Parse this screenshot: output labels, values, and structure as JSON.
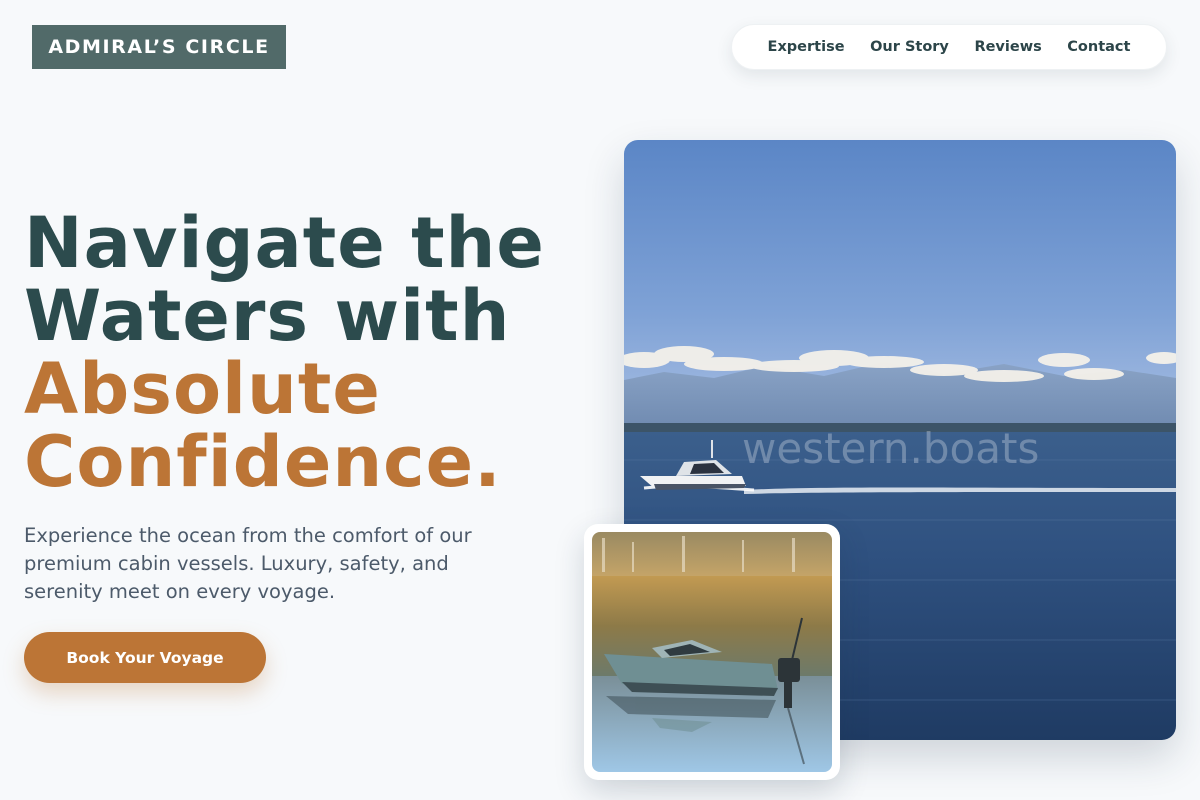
{
  "brand": {
    "name": "ADMIRAL’S CIRCLE"
  },
  "nav": {
    "items": [
      {
        "label": "Expertise"
      },
      {
        "label": "Our Story"
      },
      {
        "label": "Reviews"
      },
      {
        "label": "Contact"
      }
    ]
  },
  "hero": {
    "headline_line1": "Navigate the",
    "headline_line2": "Waters with",
    "headline_line3": "Absolute",
    "headline_line4": "Confidence.",
    "subtext": "Experience the ocean from the comfort of our premium cabin vessels. Luxury, safety, and serenity meet on every voyage.",
    "cta_label": "Book Your Voyage"
  },
  "images": {
    "main_watermark": "western.boats"
  },
  "colors": {
    "primary": "#2c4b4d",
    "accent": "#bc7536",
    "logo_bg": "#516a69",
    "background": "#f7f9fb"
  }
}
